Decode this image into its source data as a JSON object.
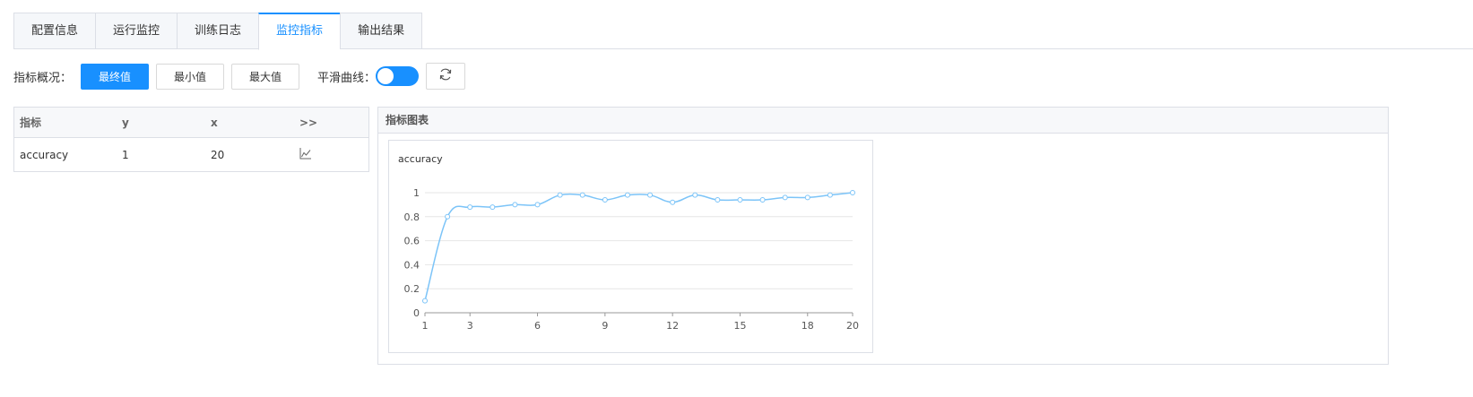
{
  "tabs": [
    {
      "label": "配置信息",
      "active": false
    },
    {
      "label": "运行监控",
      "active": false
    },
    {
      "label": "训练日志",
      "active": false
    },
    {
      "label": "监控指标",
      "active": true
    },
    {
      "label": "输出结果",
      "active": false
    }
  ],
  "toolbar": {
    "overview_label": "指标概况：",
    "final_label": "最终值",
    "min_label": "最小值",
    "max_label": "最大值",
    "smooth_label": "平滑曲线：",
    "smooth_on": true,
    "refresh_icon": "refresh-icon"
  },
  "table": {
    "headers": [
      "指标",
      "y",
      "x",
      ">>"
    ],
    "rows": [
      {
        "metric": "accuracy",
        "y": "1",
        "x": "20",
        "icon": "line-chart-icon"
      }
    ]
  },
  "panel": {
    "title": "指标图表"
  },
  "colors": {
    "accent": "#1890ff",
    "series": "#7cc4f8"
  },
  "chart_data": {
    "type": "line",
    "title": "accuracy",
    "xlabel": "",
    "ylabel": "",
    "x": [
      1,
      2,
      3,
      4,
      5,
      6,
      7,
      8,
      9,
      10,
      11,
      12,
      13,
      14,
      15,
      16,
      17,
      18,
      19,
      20
    ],
    "values": [
      0.1,
      0.8,
      0.88,
      0.88,
      0.9,
      0.9,
      0.98,
      0.98,
      0.94,
      0.98,
      0.98,
      0.92,
      0.98,
      0.94,
      0.94,
      0.94,
      0.96,
      0.96,
      0.98,
      1.0
    ],
    "xticks": [
      1,
      3,
      6,
      9,
      12,
      15,
      18,
      20
    ],
    "yticks": [
      0,
      0.2,
      0.4,
      0.6,
      0.8,
      1
    ],
    "ylim": [
      0,
      1
    ],
    "xlim": [
      1,
      20
    ],
    "smooth": true,
    "grid": true
  }
}
